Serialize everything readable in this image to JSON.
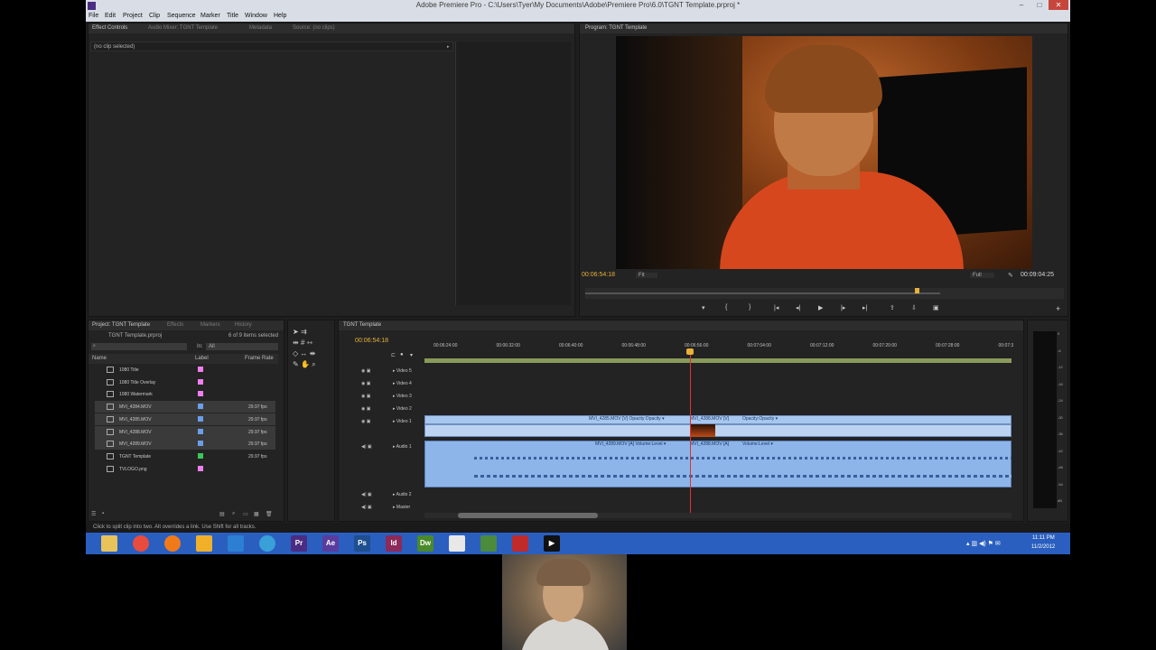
{
  "window": {
    "title": "Adobe Premiere Pro - C:\\Users\\Tyer\\My Documents\\Adobe\\Premiere Pro\\6.0\\TGNT Template.prproj *",
    "minimize": "–",
    "maximize": "□",
    "close": "✕"
  },
  "menu": [
    "File",
    "Edit",
    "Project",
    "Clip",
    "Sequence",
    "Marker",
    "Title",
    "Window",
    "Help"
  ],
  "source_panel": {
    "tabs": [
      "Effect Controls",
      "Audio Mixer: TGNT Template",
      "Metadata",
      "Source: (no clips)"
    ],
    "no_clip": "(no clip selected)"
  },
  "program_panel": {
    "tab": "Program: TGNT Template",
    "timecode": "00:06:54:18",
    "fit": "Fit",
    "quality": "Full",
    "duration": "00:09:04:25"
  },
  "project_panel": {
    "tabs": [
      "Project: TGNT Template",
      "Effects",
      "Markers",
      "History"
    ],
    "project_file": "TGNT Template.prproj",
    "items_selected": "6 of 9 items selected",
    "in_label": "In:",
    "in_value": "All",
    "columns": [
      "Name",
      "Label",
      "Frame Rate"
    ],
    "items": [
      {
        "name": "1080 Title",
        "label_color": "#f07ef0",
        "frame_rate": "",
        "selected": false
      },
      {
        "name": "1080 Title Overlay",
        "label_color": "#f07ef0",
        "frame_rate": "",
        "selected": false
      },
      {
        "name": "1080 Watermark",
        "label_color": "#f07ef0",
        "frame_rate": "",
        "selected": false
      },
      {
        "name": "MVI_4284.MOV",
        "label_color": "#6a9ee8",
        "frame_rate": "29.97 fps",
        "selected": true
      },
      {
        "name": "MVI_4285.MOV",
        "label_color": "#6a9ee8",
        "frame_rate": "29.97 fps",
        "selected": true
      },
      {
        "name": "MVI_4288.MOV",
        "label_color": "#6a9ee8",
        "frame_rate": "29.97 fps",
        "selected": true
      },
      {
        "name": "MVI_4289.MOV",
        "label_color": "#6a9ee8",
        "frame_rate": "29.97 fps",
        "selected": true
      },
      {
        "name": "TGNT Template",
        "label_color": "#3cc65a",
        "frame_rate": "29.97 fps",
        "selected": false
      },
      {
        "name": "TVLOGO.png",
        "label_color": "#f07ef0",
        "frame_rate": "",
        "selected": false
      }
    ]
  },
  "timeline": {
    "tab": "TGNT Template",
    "timecode": "00:06:54:18",
    "ruler": [
      "00:06:24:00",
      "00:06:32:00",
      "00:06:40:00",
      "00:06:48:00",
      "00:06:56:00",
      "00:07:04:00",
      "00:07:12:00",
      "00:07:20:00",
      "00:07:28:00",
      "00:07:3"
    ],
    "tracks": [
      "Video 5",
      "Video 4",
      "Video 3",
      "Video 2",
      "Video 1",
      "Audio 1",
      "Audio 2",
      "Master"
    ],
    "clips": {
      "v1_a": "MVI_4285.MOV [V]  Opacity:Opacity ▾",
      "v1_b": "MVI_4288.MOV [V]",
      "v1_b_fx": "Opacity:Opacity ▾",
      "a1_a": "MVI_4289.MOV [A]  Volume:Level ▾",
      "a1_b": "MVI_4288.MOV [A]",
      "a1_b_fx": "Volume:Level ▾"
    }
  },
  "audio_meter": [
    "0",
    "-6",
    "-12",
    "-18",
    "-24",
    "-30",
    "-36",
    "-42",
    "-48",
    "-54",
    "dB"
  ],
  "status": "Click to split clip into two. Alt overrides a link. Use Shift for all tracks.",
  "taskbar": {
    "apps": [
      "Explorer",
      "Chrome",
      "Firefox",
      "Folder",
      "Outlook",
      "Safari",
      "Pr",
      "Ae",
      "Ps",
      "Id",
      "Dw",
      "Files",
      "Minecraft",
      "Camera",
      "Media"
    ],
    "clock_time": "11:11 PM",
    "clock_date": "11/2/2012"
  }
}
